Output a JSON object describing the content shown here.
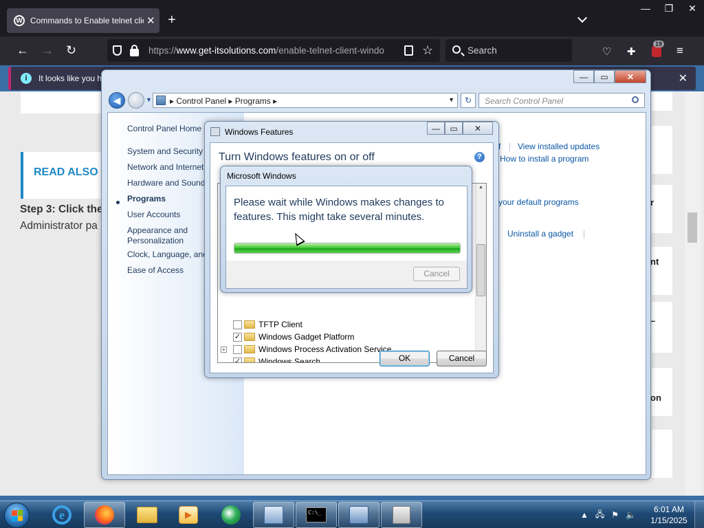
{
  "browser": {
    "tab_title": "Commands to Enable telnet client",
    "new_tab": "+",
    "url_protocol": "https://",
    "url_host": "www.get-itsolutions.com",
    "url_path": "/enable-telnet-client-windo",
    "search_placeholder": "Search",
    "badge_count": "19",
    "notification": "It looks like you h",
    "window_controls": {
      "minimize": "—",
      "restore": "❐",
      "close": "✕"
    }
  },
  "web": {
    "read_also": "READ ALSO -",
    "step_title": "Step 3: Click the",
    "step_text": "Administrator pa",
    "side_labels": [
      "r",
      "nt",
      "–",
      "on"
    ]
  },
  "control_panel": {
    "breadcrumb": "▸  Control Panel  ▸  Programs  ▸",
    "search_placeholder": "Search Control Panel",
    "nav": [
      "Control Panel Home",
      "System and Security",
      "Network and Internet",
      "Hardware and Sound",
      "Programs",
      "User Accounts",
      "Appearance and Personalization",
      "Clock, Language, and",
      "Ease of Access"
    ],
    "links": {
      "view_installed_updates": "View installed updates",
      "how_to_install": "How to install a program",
      "default_programs": "your default programs",
      "uninstall_gadget": "Uninstall a gadget",
      "f_fragment": "f"
    }
  },
  "windows_features": {
    "title": "Windows Features",
    "heading": "Turn Windows features on or off",
    "features": [
      {
        "name": "TFTP Client",
        "checked": false,
        "expandable": false
      },
      {
        "name": "Windows Gadget Platform",
        "checked": true,
        "expandable": false
      },
      {
        "name": "Windows Process Activation Service",
        "checked": false,
        "expandable": true
      },
      {
        "name": "Windows Search",
        "checked": true,
        "expandable": false
      }
    ],
    "ok_label": "OK",
    "cancel_label": "Cancel"
  },
  "progress_dialog": {
    "title": "Microsoft Windows",
    "message": "Please wait while Windows makes changes to features. This might take several minutes.",
    "progress": 1.0,
    "cancel_label": "Cancel"
  },
  "taskbar": {
    "time": "6:01 AM",
    "date": "1/15/2025"
  },
  "colors": {
    "progress_green": "#37c22a",
    "link_blue": "#0b57a4",
    "read_also_blue": "#1e88c7",
    "firefox_dark": "#1c1b22"
  }
}
